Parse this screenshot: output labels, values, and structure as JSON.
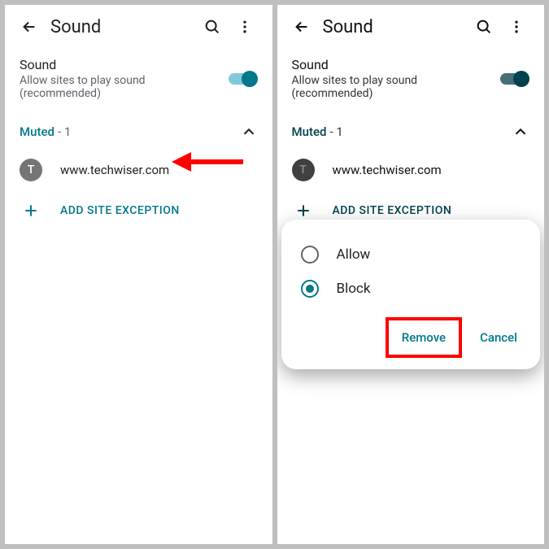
{
  "left": {
    "header": {
      "title": "Sound"
    },
    "setting": {
      "title": "Sound",
      "subtitle": "Allow sites to play sound (recommended)",
      "enabled": true
    },
    "section": {
      "label": "Muted",
      "count": "- 1"
    },
    "site": {
      "favicon_letter": "T",
      "url": "www.techwiser.com"
    },
    "add": {
      "label": "ADD SITE EXCEPTION"
    }
  },
  "right": {
    "header": {
      "title": "Sound"
    },
    "setting": {
      "title": "Sound",
      "subtitle": "Allow sites to play sound (recommended)",
      "enabled": true
    },
    "section": {
      "label": "Muted",
      "count": "- 1"
    },
    "site": {
      "favicon_letter": "T",
      "url": "www.techwiser.com"
    },
    "add": {
      "label": "ADD SITE EXCEPTION"
    },
    "dialog": {
      "options": {
        "allow": "Allow",
        "block": "Block"
      },
      "selected": "block",
      "remove": "Remove",
      "cancel": "Cancel"
    }
  },
  "annotations": {
    "arrow_target": "site-row-left",
    "highlight_target": "remove-button"
  }
}
